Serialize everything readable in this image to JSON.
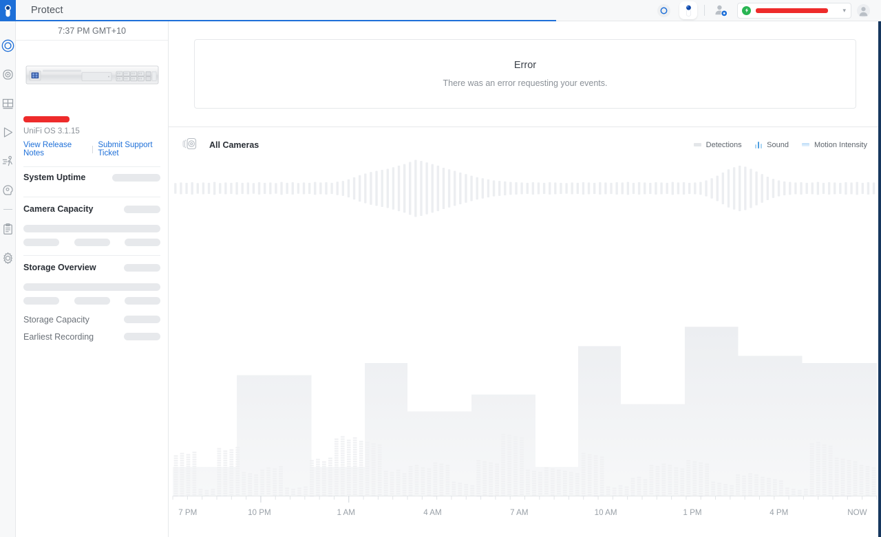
{
  "app": {
    "brand_color": "#1d6fd8",
    "title": "Protect"
  },
  "rail": {
    "logo_icon": "unifi-protect-logo-icon",
    "items": [
      {
        "name": "sidebar-item-dashboard",
        "icon": "live-view-icon",
        "active": true
      },
      {
        "name": "sidebar-item-cameras",
        "icon": "camera-icon",
        "active": false
      },
      {
        "name": "sidebar-item-liveview-grid",
        "icon": "grid-layout-icon",
        "active": false
      },
      {
        "name": "sidebar-item-playback",
        "icon": "play-triangle-icon",
        "active": false
      },
      {
        "name": "sidebar-item-motion-events",
        "icon": "running-person-icon",
        "active": false
      },
      {
        "name": "sidebar-item-ai-detections",
        "icon": "face-detection-icon",
        "active": false
      },
      {
        "name": "sidebar-item-reports",
        "icon": "clipboard-icon",
        "active": false
      },
      {
        "name": "sidebar-item-settings",
        "icon": "gear-icon",
        "active": false
      }
    ]
  },
  "header": {
    "title": "Protect",
    "apps": [
      {
        "name": "header-app-network",
        "icon": "access-point-icon",
        "active": false
      },
      {
        "name": "header-app-protect",
        "icon": "protect-camera-icon",
        "active": true
      }
    ],
    "admin_icon": "user-settings-icon",
    "chip": {
      "badge_icon": "plus-circle-icon",
      "badge_color": "#29b553",
      "label_redacted": true,
      "redaction_color": "#ee2b2b",
      "chevron_icon": "chevron-down-icon"
    },
    "avatar_icon": "user-avatar-icon"
  },
  "console": {
    "clock": "7:37 PM GMT+10",
    "device_icon": "udm-pro-device-icon",
    "device_name_redacted": true,
    "redaction_color": "#ee2b2b",
    "os_version": "UniFi OS 3.1.15",
    "links": [
      {
        "name": "view-release-notes-link",
        "label": "View Release Notes"
      },
      {
        "name": "submit-support-ticket-link",
        "label": "Submit Support Ticket"
      }
    ],
    "sections": [
      {
        "name": "system-uptime-section",
        "title": "System Uptime",
        "loading": true
      },
      {
        "name": "camera-capacity-section",
        "title": "Camera Capacity",
        "loading": true
      },
      {
        "name": "storage-overview-section",
        "title": "Storage Overview",
        "loading": true
      }
    ],
    "storage_rows": [
      {
        "name": "storage-capacity-row",
        "label": "Storage Capacity",
        "loading": true
      },
      {
        "name": "earliest-recording-row",
        "label": "Earliest Recording",
        "loading": true
      }
    ]
  },
  "error_card": {
    "title": "Error",
    "message": "There was an error requesting your events."
  },
  "chart_panel": {
    "camera_icon": "camera-stack-icon",
    "camera_label": "All Cameras",
    "legend": [
      {
        "name": "legend-detections",
        "label": "Detections",
        "icon": "square-swatch-icon",
        "color": "#e3e6e9"
      },
      {
        "name": "legend-sound",
        "label": "Sound",
        "icon": "sound-bars-icon",
        "color": "#8ec8f0"
      },
      {
        "name": "legend-motion-intensity",
        "label": "Motion Intensity",
        "icon": "square-swatch-icon",
        "color": "#bcdcf7"
      }
    ]
  },
  "chart_data": {
    "type": "area",
    "title": "All Cameras",
    "xlabel": "",
    "ylabel": "",
    "grid": false,
    "legend_position": "top-right",
    "state": "loading-placeholder",
    "axis_ticks": [
      "7 PM",
      "10 PM",
      "1 AM",
      "4 AM",
      "7 AM",
      "10 AM",
      "1 PM",
      "4 PM",
      "NOW"
    ],
    "tick_positions_pct": [
      0.8,
      12.3,
      24.6,
      36.9,
      49.2,
      61.5,
      73.8,
      86.1,
      98.6
    ],
    "x_range": [
      "7 PM",
      "NOW"
    ],
    "series": [
      {
        "name": "Sound",
        "type": "waveform",
        "color": "#eceef1",
        "values": [
          12,
          14,
          13,
          15,
          12,
          14,
          13,
          16,
          12,
          14,
          13,
          15,
          13,
          14,
          12,
          15,
          13,
          14,
          12,
          16,
          13,
          15,
          12,
          14,
          13,
          16,
          14,
          15,
          13,
          17,
          20,
          26,
          34,
          42,
          48,
          54,
          58,
          62,
          66,
          72,
          78,
          84,
          92,
          100,
          96,
          90,
          84,
          78,
          70,
          64,
          58,
          52,
          46,
          40,
          34,
          30,
          26,
          22,
          20,
          18,
          16,
          15,
          14,
          13,
          15,
          14,
          13,
          15,
          14,
          13,
          12,
          14,
          13,
          15,
          14,
          13,
          15,
          14,
          13,
          15,
          14,
          16,
          13,
          15,
          14,
          13,
          15,
          14,
          13,
          16,
          14,
          15,
          13,
          14,
          16,
          22,
          30,
          40,
          52,
          64,
          72,
          78,
          74,
          66,
          56,
          46,
          36,
          28,
          22,
          18,
          16,
          14,
          15,
          13,
          14,
          16,
          13,
          15,
          14,
          13,
          15,
          14,
          16,
          13,
          15,
          14
        ]
      },
      {
        "name": "Motion Intensity",
        "type": "step-area",
        "color": "#f0f2f4",
        "values": [
          12,
          12,
          12,
          12,
          12,
          12,
          50,
          50,
          50,
          50,
          50,
          50,
          50,
          12,
          12,
          12,
          12,
          12,
          55,
          55,
          55,
          55,
          35,
          35,
          35,
          35,
          35,
          35,
          42,
          42,
          42,
          42,
          42,
          42,
          12,
          12,
          12,
          12,
          62,
          62,
          62,
          62,
          38,
          38,
          38,
          38,
          38,
          38,
          70,
          70,
          70,
          70,
          70,
          58,
          58,
          58,
          58,
          58,
          58,
          55,
          55,
          55,
          55,
          55,
          55,
          55
        ]
      },
      {
        "name": "Detections",
        "type": "bar",
        "color": "#f2f3f5",
        "values": [
          34,
          36,
          35,
          37,
          6,
          5,
          6,
          40,
          38,
          39,
          41,
          20,
          19,
          18,
          22,
          24,
          23,
          25,
          7,
          6,
          7,
          8,
          30,
          31,
          29,
          32,
          48,
          50,
          47,
          49,
          46,
          45,
          44,
          43,
          21,
          20,
          22,
          19,
          25,
          26,
          24,
          23,
          28,
          27,
          26,
          12,
          11,
          10,
          9,
          30,
          29,
          28,
          27,
          52,
          51,
          50,
          49,
          22,
          21,
          20,
          24,
          23,
          22,
          21,
          20,
          19,
          36,
          35,
          34,
          33,
          8,
          7,
          9,
          8,
          15,
          16,
          14,
          26,
          25,
          27,
          26,
          24,
          23,
          30,
          29,
          28,
          27,
          12,
          11,
          10,
          9,
          18,
          17,
          19,
          18,
          16,
          15,
          14,
          13,
          7,
          6,
          5,
          6,
          44,
          45,
          43,
          42,
          32,
          31,
          30,
          29,
          26,
          25,
          24
        ]
      }
    ]
  }
}
